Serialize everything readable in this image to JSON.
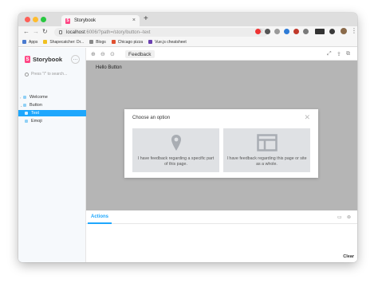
{
  "browser": {
    "tab_title": "Storybook",
    "tab_close": "×",
    "new_tab": "+",
    "url_host": "localhost",
    "url_rest": ":6006/?path=/story/button--text",
    "back": "←",
    "forward": "→",
    "reload": "↻",
    "star": "☆",
    "menu": "⋮",
    "bookmarks": [
      {
        "label": "Apps",
        "color": "#4a7bd0"
      },
      {
        "label": "Shapecatcher: Dr...",
        "color": "#f0c020"
      },
      {
        "label": "Blogs",
        "color": "#888888"
      },
      {
        "label": "Chicago pizza",
        "color": "#e05030"
      },
      {
        "label": "Vue.js cheatsheet",
        "color": "#6a3fb0"
      }
    ]
  },
  "storybook": {
    "brand": "Storybook",
    "more": "···",
    "search_placeholder": "Press \"/\" to search...",
    "tree": [
      {
        "label": "Welcome",
        "chev": "›"
      },
      {
        "label": "Button",
        "chev": "⌄"
      },
      {
        "label": "Text",
        "chev": ""
      },
      {
        "label": "Emoji",
        "chev": ""
      }
    ],
    "toolbar": {
      "zoom_in": "⊕",
      "zoom_out": "⊖",
      "zoom_reset": "⊙",
      "tab_label": "Feedback",
      "fullscreen": "⤢",
      "share": "⇪",
      "copy": "⧉"
    },
    "story_content": "Hello Button",
    "modal": {
      "title": "Choose an option",
      "close": "✕",
      "option_specific": "I have feedback regarding a specific part of this page.",
      "option_whole": "I have feedback regarding this page or site as a whole."
    },
    "addons": {
      "tab": "Actions",
      "clear": "Clear",
      "layout_icon": "▭",
      "settings_icon": "⊚"
    }
  },
  "colors": {
    "accent": "#1ea7fd",
    "brand": "#ff4785"
  }
}
